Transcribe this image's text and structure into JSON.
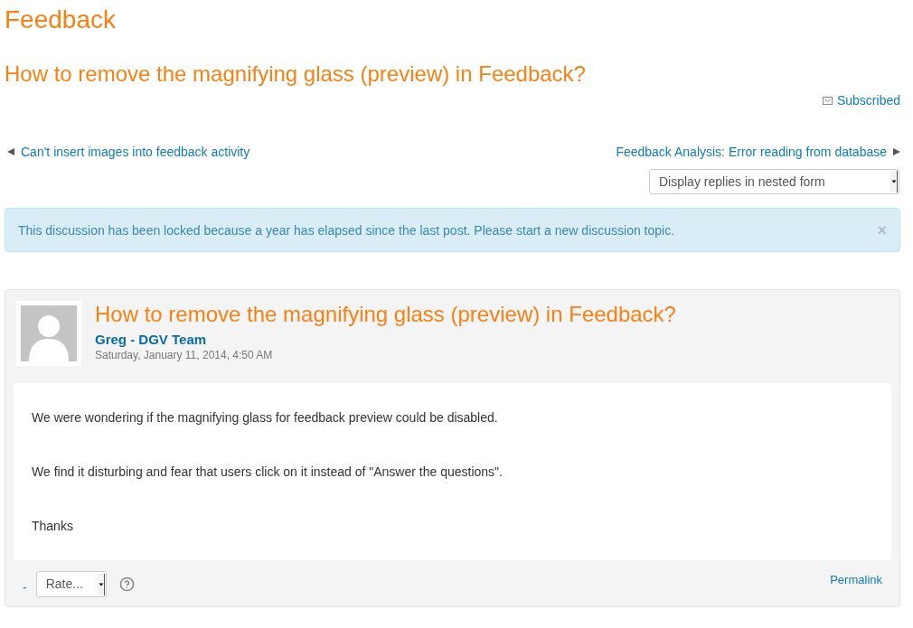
{
  "page_title": "Feedback",
  "discussion_title": "How to remove the magnifying glass (preview) in Feedback?",
  "subscription": {
    "label": "Subscribed"
  },
  "navigation": {
    "previous": "Can't insert images into feedback activity",
    "next": "Feedback Analysis: Error reading from database"
  },
  "display_mode": {
    "value": "Display replies in nested form"
  },
  "alert": {
    "message": "This discussion has been locked because a year has elapsed since the last post. Please start a new discussion topic.",
    "close": "×"
  },
  "post": {
    "subject": "How to remove the magnifying glass (preview) in Feedback?",
    "author": "Greg - DGV Team",
    "date": "Saturday, January 11, 2014, 4:50 AM",
    "paragraphs": [
      "We were wondering if the magnifying glass for feedback preview could be disabled.",
      "We find it disturbing and fear that users click on it instead of \"Answer the questions\".",
      "Thanks"
    ],
    "footer": {
      "toggle": "-",
      "rating": {
        "value": "Rate..."
      },
      "permalink": "Permalink"
    }
  }
}
